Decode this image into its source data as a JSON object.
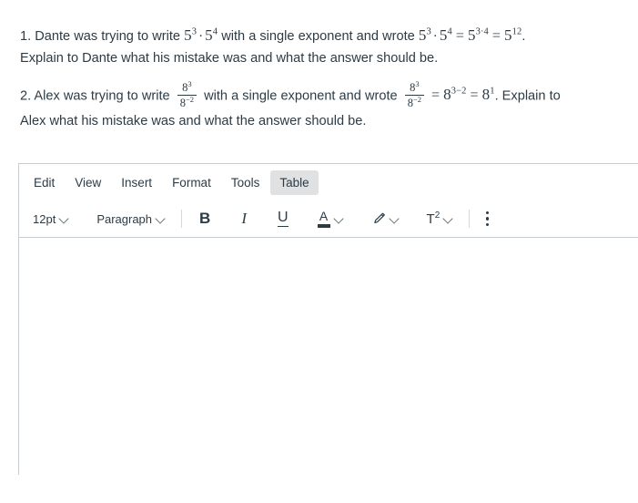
{
  "questions": [
    {
      "number": "1.",
      "lead": "Dante was trying to write",
      "expr1": {
        "base1": "5",
        "exp1": "3",
        "op": "·",
        "base2": "5",
        "exp2": "4"
      },
      "middle": "with a single exponent and wrote",
      "expr2": {
        "base1": "5",
        "exp1": "3",
        "op": "·",
        "base2": "5",
        "exp2": "4",
        "eq1": "=",
        "base3": "5",
        "exp3": "3·4",
        "eq2": "=",
        "base4": "5",
        "exp4": "12"
      },
      "tail": ".",
      "line2": "Explain to Dante what his mistake was and what the answer should be."
    },
    {
      "number": "2.",
      "lead": "Alex was trying to write",
      "frac1": {
        "num_base": "8",
        "num_exp": "3",
        "den_base": "8",
        "den_exp": "−2"
      },
      "middle": "with a single exponent and wrote",
      "frac2": {
        "num_base": "8",
        "num_exp": "3",
        "den_base": "8",
        "den_exp": "−2"
      },
      "expr2": {
        "eq1": "=",
        "base1": "8",
        "exp1": "3−2",
        "eq2": "=",
        "base2": "8",
        "exp2": "1"
      },
      "tail": ". Explain to",
      "line2": "Alex what his mistake was and what the answer should be."
    }
  ],
  "editor": {
    "menubar": [
      {
        "label": "Edit",
        "name": "menu-item-edit",
        "active": false
      },
      {
        "label": "View",
        "name": "menu-item-view",
        "active": false
      },
      {
        "label": "Insert",
        "name": "menu-item-insert",
        "active": false
      },
      {
        "label": "Format",
        "name": "menu-item-format",
        "active": false
      },
      {
        "label": "Tools",
        "name": "menu-item-tools",
        "active": false
      },
      {
        "label": "Table",
        "name": "menu-item-table",
        "active": true
      }
    ],
    "toolbar": {
      "font_size": "12pt",
      "block_format": "Paragraph",
      "bold_label": "B",
      "italic_label": "I",
      "underline_label": "U",
      "text_color_label": "A",
      "superscript_label": "T",
      "superscript_exp": "2",
      "more_options_label": "⋮"
    },
    "colors": {
      "text_color_swatch": "#2d3b45",
      "highlight_swatch": "#2d3b45",
      "active_menu_bg": "#dfe1e3",
      "border": "#c7cdd1",
      "body_text": "#2d3b45"
    },
    "content": ""
  }
}
